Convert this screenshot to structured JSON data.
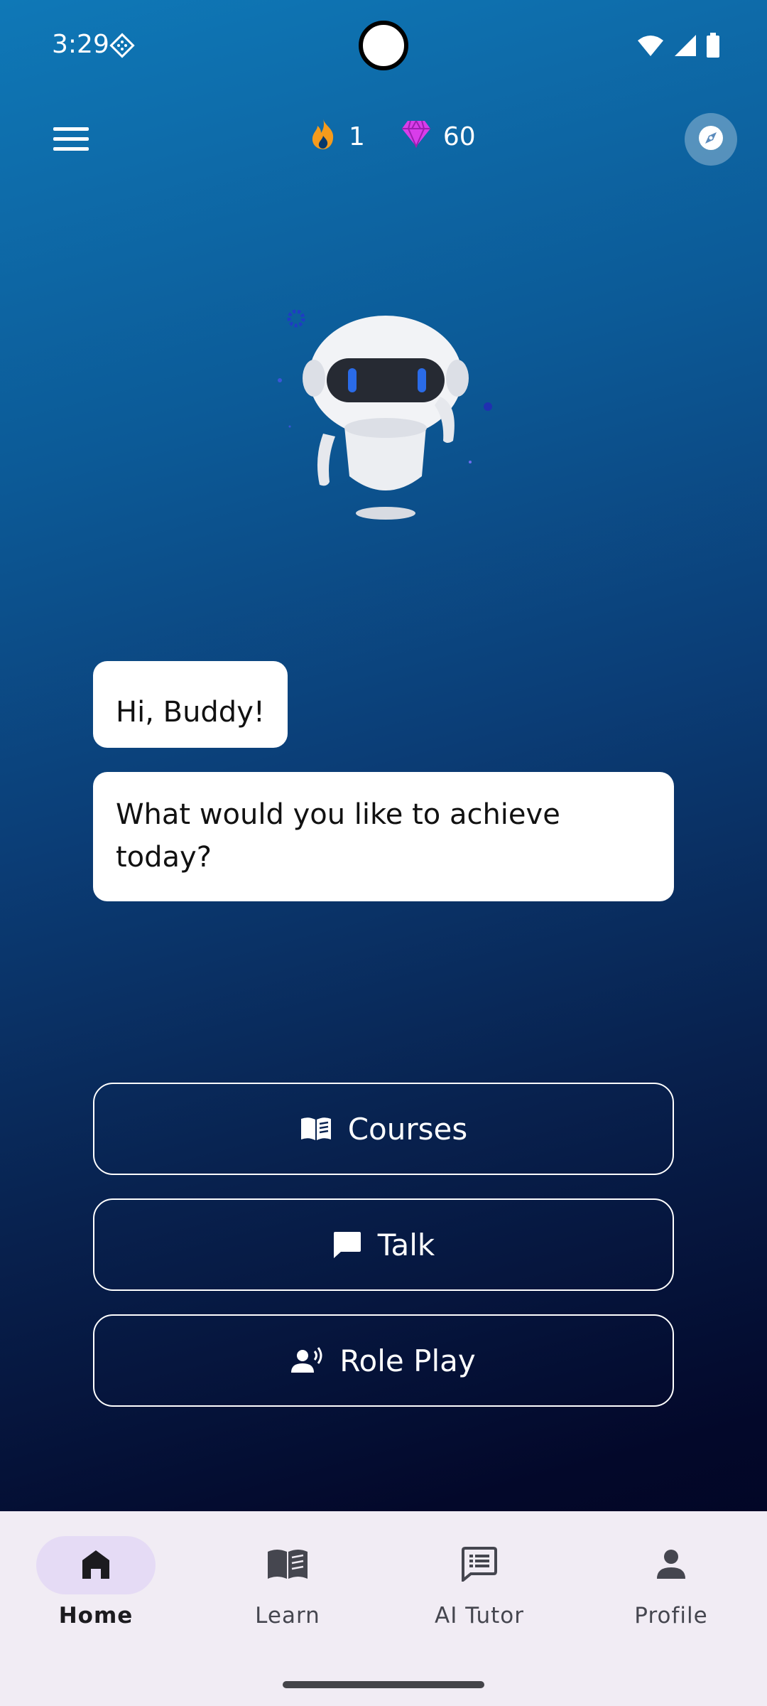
{
  "status_bar": {
    "time": "3:29",
    "icons": [
      "notification-diamond-icon",
      "wifi-icon",
      "signal-icon",
      "battery-icon"
    ]
  },
  "top_bar": {
    "menu_icon": "hamburger-menu-icon",
    "streak": {
      "icon": "flame-icon",
      "value": "1",
      "color": "#f59b1c"
    },
    "gems": {
      "icon": "gem-icon",
      "value": "60",
      "color": "#d93dea"
    },
    "compass_icon": "compass-icon"
  },
  "mascot": {
    "icon": "robot-mascot"
  },
  "chat": {
    "greeting": "Hi, Buddy!",
    "question": "What would you like to achieve today?"
  },
  "actions": [
    {
      "label": "Courses",
      "icon": "open-book-icon"
    },
    {
      "label": "Talk",
      "icon": "chat-bubble-icon"
    },
    {
      "label": "Role Play",
      "icon": "speaking-person-icon"
    }
  ],
  "bottom_nav": {
    "items": [
      {
        "label": "Home",
        "icon": "home-icon",
        "active": true
      },
      {
        "label": "Learn",
        "icon": "book-icon",
        "active": false
      },
      {
        "label": "AI Tutor",
        "icon": "message-list-icon",
        "active": false
      },
      {
        "label": "Profile",
        "icon": "person-icon",
        "active": false
      }
    ]
  },
  "colors": {
    "gradient_top": "#0f78b7",
    "gradient_bottom": "#01031f",
    "nav_background": "#f1ecf4",
    "active_pill": "#e5dbf5"
  }
}
